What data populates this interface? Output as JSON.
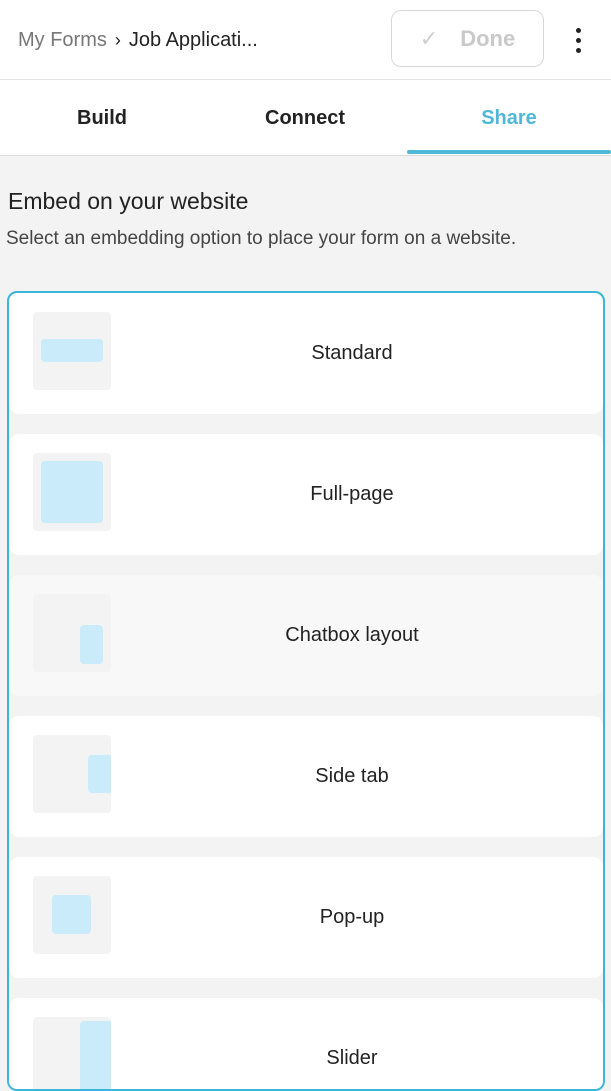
{
  "header": {
    "breadcrumb_root": "My Forms",
    "breadcrumb_sep": "›",
    "breadcrumb_current": "Job Applicati...",
    "done_label": "Done"
  },
  "tabs": [
    {
      "label": "Build",
      "active": false
    },
    {
      "label": "Connect",
      "active": false
    },
    {
      "label": "Share",
      "active": true
    }
  ],
  "embed": {
    "title": "Embed on your website",
    "description": "Select an embedding option to place your form on a website.",
    "options": [
      {
        "label": "Standard",
        "icon": "standard-layout-icon"
      },
      {
        "label": "Full-page",
        "icon": "full-page-layout-icon"
      },
      {
        "label": "Chatbox layout",
        "icon": "chatbox-layout-icon"
      },
      {
        "label": "Side tab",
        "icon": "side-tab-layout-icon"
      },
      {
        "label": "Pop-up",
        "icon": "popup-layout-icon"
      },
      {
        "label": "Slider",
        "icon": "slider-layout-icon"
      }
    ]
  },
  "colors": {
    "accent": "#4fb8d6",
    "thumb_shape": "#c9ebfa",
    "panel_border": "#3cb6d8"
  }
}
